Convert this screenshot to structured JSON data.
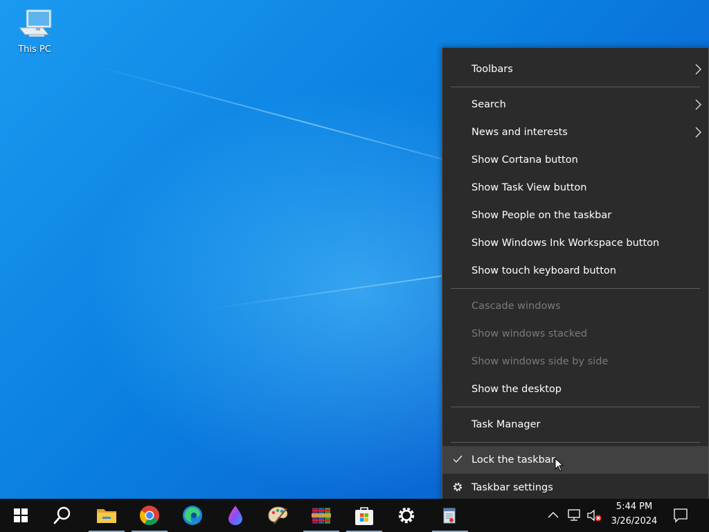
{
  "desktop": {
    "icons": [
      {
        "label": "This PC",
        "icon": "computer-icon"
      }
    ]
  },
  "context_menu": {
    "items": [
      {
        "label": "Toolbars",
        "submenu": true,
        "enabled": true
      },
      {
        "label": "Search",
        "submenu": true,
        "enabled": true
      },
      {
        "label": "News and interests",
        "submenu": true,
        "enabled": true
      },
      {
        "label": "Show Cortana button",
        "enabled": true
      },
      {
        "label": "Show Task View button",
        "enabled": true
      },
      {
        "label": "Show People on the taskbar",
        "enabled": true
      },
      {
        "label": "Show Windows Ink Workspace button",
        "enabled": true
      },
      {
        "label": "Show touch keyboard button",
        "enabled": true
      },
      {
        "label": "Cascade windows",
        "enabled": false
      },
      {
        "label": "Show windows stacked",
        "enabled": false
      },
      {
        "label": "Show windows side by side",
        "enabled": false
      },
      {
        "label": "Show the desktop",
        "enabled": true
      },
      {
        "label": "Task Manager",
        "enabled": true
      },
      {
        "label": "Lock the taskbar",
        "enabled": true,
        "checked": true,
        "hovered": true,
        "icon": "checkmark-icon"
      },
      {
        "label": "Taskbar settings",
        "enabled": true,
        "icon": "gear-icon"
      }
    ]
  },
  "taskbar": {
    "buttons": [
      {
        "name": "Start",
        "icon": "windows-logo-icon"
      },
      {
        "name": "Search",
        "icon": "search-icon"
      },
      {
        "name": "File Explorer",
        "icon": "folder-icon",
        "running": true
      },
      {
        "name": "Google Chrome",
        "icon": "chrome-icon",
        "running": true
      },
      {
        "name": "Microsoft Edge",
        "icon": "edge-icon"
      },
      {
        "name": "Paint 3D",
        "icon": "paint-drop-icon"
      },
      {
        "name": "Paint",
        "icon": "palette-icon"
      },
      {
        "name": "WinRAR",
        "icon": "books-icon",
        "running": true
      },
      {
        "name": "Microsoft Store",
        "icon": "store-bag-icon",
        "running": true
      },
      {
        "name": "Settings",
        "icon": "gear-icon"
      },
      {
        "name": "Notepad",
        "icon": "notepad-icon",
        "running": true
      }
    ],
    "tray": {
      "time": "5:44 PM",
      "date": "3/26/2024",
      "icons": [
        "chevron-up-icon",
        "network-icon",
        "volume-muted-icon",
        "notification-icon"
      ]
    }
  },
  "colors": {
    "menu_bg": "#2b2b2b",
    "menu_hover": "#414141",
    "taskbar_bg": "#101010",
    "disabled_text": "#7a7a7a"
  }
}
